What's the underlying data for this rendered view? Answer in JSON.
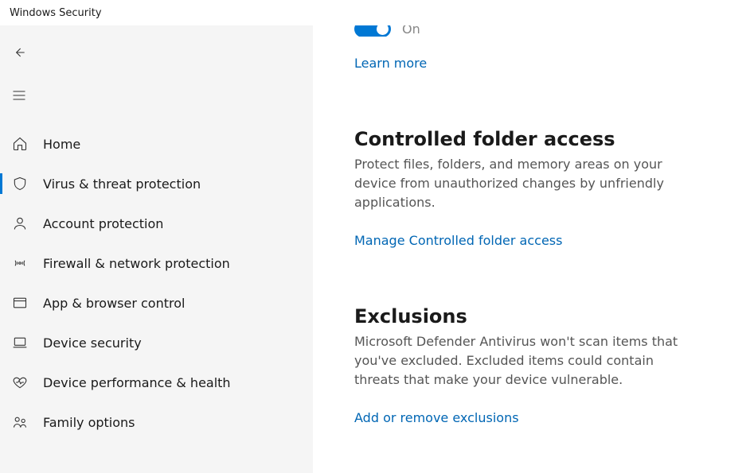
{
  "window": {
    "title": "Windows Security"
  },
  "sidebar": {
    "items": [
      {
        "label": "Home",
        "icon": "home-icon",
        "active": false
      },
      {
        "label": "Virus & threat protection",
        "icon": "shield-icon",
        "active": true
      },
      {
        "label": "Account protection",
        "icon": "person-icon",
        "active": false
      },
      {
        "label": "Firewall & network protection",
        "icon": "antenna-icon",
        "active": false
      },
      {
        "label": "App & browser control",
        "icon": "browser-icon",
        "active": false
      },
      {
        "label": "Device security",
        "icon": "laptop-icon",
        "active": false
      },
      {
        "label": "Device performance & health",
        "icon": "heart-icon",
        "active": false
      },
      {
        "label": "Family options",
        "icon": "family-icon",
        "active": false
      }
    ]
  },
  "main": {
    "toggle": {
      "state": "On",
      "checked": true
    },
    "learn_more": "Learn more",
    "sections": [
      {
        "heading": "Controlled folder access",
        "desc": "Protect files, folders, and memory areas on your device from unauthorized changes by unfriendly applications.",
        "link": "Manage Controlled folder access"
      },
      {
        "heading": "Exclusions",
        "desc": "Microsoft Defender Antivirus won't scan items that you've excluded. Excluded items could contain threats that make your device vulnerable.",
        "link": "Add or remove exclusions"
      }
    ]
  },
  "colors": {
    "accent": "#0078d4",
    "link": "#0066b4"
  }
}
